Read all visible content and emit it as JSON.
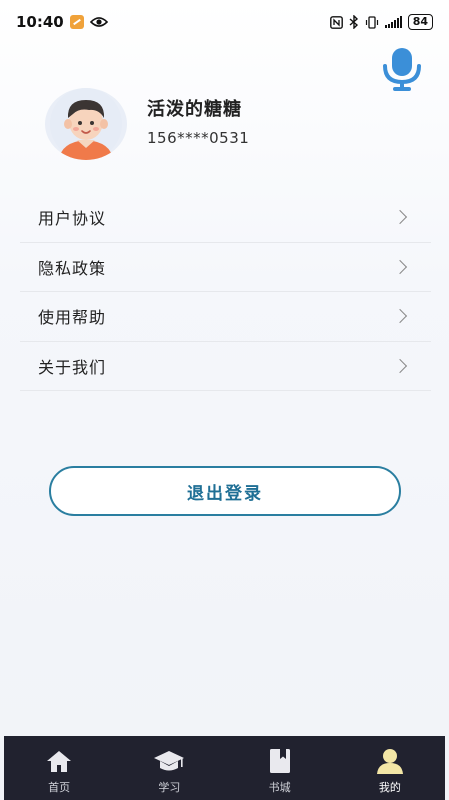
{
  "status_bar": {
    "time": "10:40",
    "battery": "84"
  },
  "profile": {
    "name": "活泼的糖糖",
    "phone": "156****0531"
  },
  "menu": {
    "items": [
      {
        "label": "用户协议"
      },
      {
        "label": "隐私政策"
      },
      {
        "label": "使用帮助"
      },
      {
        "label": "关于我们"
      }
    ]
  },
  "logout": {
    "label": "退出登录"
  },
  "bottom_nav": {
    "items": [
      {
        "label": "首页",
        "icon": "home-icon"
      },
      {
        "label": "学习",
        "icon": "graduation-cap-icon"
      },
      {
        "label": "书城",
        "icon": "book-icon"
      },
      {
        "label": "我的",
        "icon": "user-icon",
        "active": true
      }
    ]
  },
  "colors": {
    "accent": "#2a7ea0",
    "nav_bg": "#21222f",
    "mic": "#3b8fd8",
    "active_icon": "#f3e6a6"
  }
}
